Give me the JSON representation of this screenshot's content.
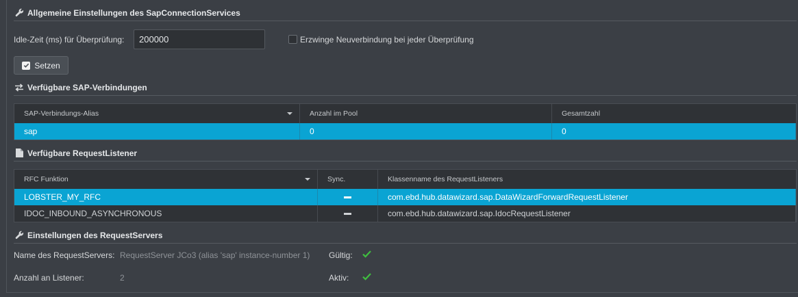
{
  "general": {
    "title": "Allgemeine Einstellungen des SapConnectionServices",
    "idle_label": "Idle-Zeit (ms) für Überprüfung:",
    "idle_value": "200000",
    "force_reconnect_label": "Erzwinge Neuverbindung bei jeder Überprüfung",
    "set_button_label": "Setzen"
  },
  "connections": {
    "title": "Verfügbare SAP-Verbindungen",
    "columns": [
      "SAP-Verbindungs-Alias",
      "Anzahl im Pool",
      "Gesamtzahl"
    ],
    "rows": [
      {
        "alias": "sap",
        "pool": "0",
        "total": "0"
      }
    ]
  },
  "listeners": {
    "title": "Verfügbare RequestListener",
    "columns": [
      "RFC Funktion",
      "Sync.",
      "Klassenname des RequestListeners"
    ],
    "rows": [
      {
        "rfc": "LOBSTER_MY_RFC",
        "classname": "com.ebd.hub.datawizard.sap.DataWizardForwardRequestListener"
      },
      {
        "rfc": "IDOC_INBOUND_ASYNCHRONOUS",
        "classname": "com.ebd.hub.datawizard.sap.IdocRequestListener"
      }
    ]
  },
  "server": {
    "title": "Einstellungen des RequestServers",
    "name_label": "Name des RequestServers:",
    "name_value": "RequestServer JCo3 (alias 'sap' instance-number 1)",
    "valid_label": "Gültig:",
    "listener_count_label": "Anzahl an Listener:",
    "listener_count_value": "2",
    "active_label": "Aktiv:"
  },
  "colors": {
    "accent": "#0aa4d3",
    "check": "#3fbf3f"
  }
}
